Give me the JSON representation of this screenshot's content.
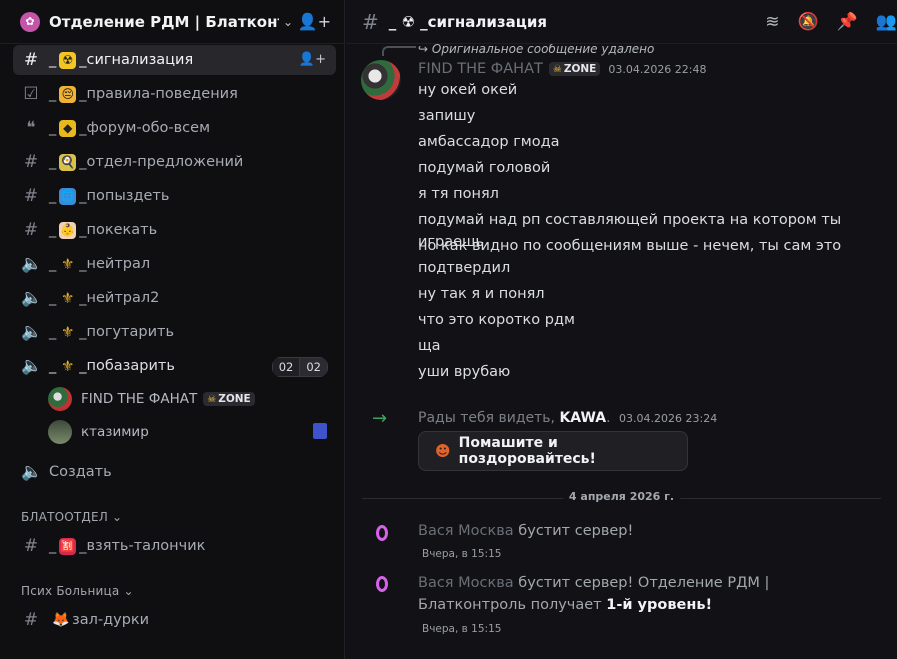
{
  "server": {
    "name": "Отделение РДМ | Блатконтроль",
    "icon": "server-icon"
  },
  "channels": [
    {
      "prefix": "_",
      "emoji": "☢",
      "name": "_сигнализация",
      "type": "text-thread",
      "active": true
    },
    {
      "prefix": "_",
      "emoji": "😔",
      "name": "_правила-поведения",
      "type": "rules"
    },
    {
      "prefix": "_",
      "emoji": "◆",
      "name": "_форум-обо-всем",
      "type": "forum"
    },
    {
      "prefix": "_",
      "emoji": "🍳",
      "name": "_отдел-предложений",
      "type": "text-thread"
    },
    {
      "prefix": "_",
      "emoji": "🌐",
      "name": "_попыздеть",
      "type": "text-thread"
    },
    {
      "prefix": "_",
      "emoji": "👶",
      "name": "_покекать",
      "type": "text-thread"
    },
    {
      "prefix": "_",
      "emoji": "⚜",
      "name": "_нейтрал",
      "type": "voice"
    },
    {
      "prefix": "_",
      "emoji": "⚜",
      "name": "_нейтрал2",
      "type": "voice"
    },
    {
      "prefix": "_",
      "emoji": "⚜",
      "name": "_погутарить",
      "type": "voice"
    },
    {
      "prefix": "_",
      "emoji": "⚜",
      "name": "_побазарить",
      "type": "voice-active",
      "count_a": "02",
      "count_b": "02"
    }
  ],
  "voice_users": [
    {
      "name": "FIND THE ФАНАТ",
      "tag": "ZONE"
    },
    {
      "name": "ктазимир"
    }
  ],
  "create_label": "Создать",
  "categories": [
    {
      "name": "БЛАТООТДЕЛ",
      "channel": {
        "prefix": "_",
        "emoji": "🈹",
        "name": "_взять-талончик"
      }
    },
    {
      "name": "Псих Больница",
      "channel": {
        "prefix": "",
        "emoji": "🦊",
        "name": "зал-дурки"
      }
    }
  ],
  "topbar": {
    "channel_title": "_ ☢ _сигнализация"
  },
  "messages": {
    "reply_text": "Оригинальное сообщение удалено",
    "author": "FIND THE ФАНАТ",
    "author_tag": "ZONE",
    "timestamp": "03.04.2026 22:48",
    "lines": [
      "ну окей окей",
      "запишу",
      "амбассадор гмода",
      "подумай головой",
      "я тя понял",
      "подумай над рп составляющей проекта на котором ты играешь",
      "но как видно по сообщениям выше - нечем, ты сам это подтвердил",
      "ну так я и понял",
      "что это коротко рдм",
      "ща",
      "уши врубаю"
    ]
  },
  "join": {
    "text": "Рады тебя видеть, ",
    "user": "KAWA",
    "timestamp": "03.04.2026 23:24",
    "button_label": "Помашите и поздоровайтесь!"
  },
  "date_divider": "4 апреля 2026 г.",
  "boosts": [
    {
      "user": "Вася Москва",
      "text": " бустит сервер!",
      "time": "Вчера, в 15:15"
    },
    {
      "user": "Вася Москва",
      "text": " бустит сервер! Отделение РДМ | Блатконтроль получает ",
      "level": "1-й уровень!",
      "time": "Вчера, в 15:15"
    }
  ]
}
